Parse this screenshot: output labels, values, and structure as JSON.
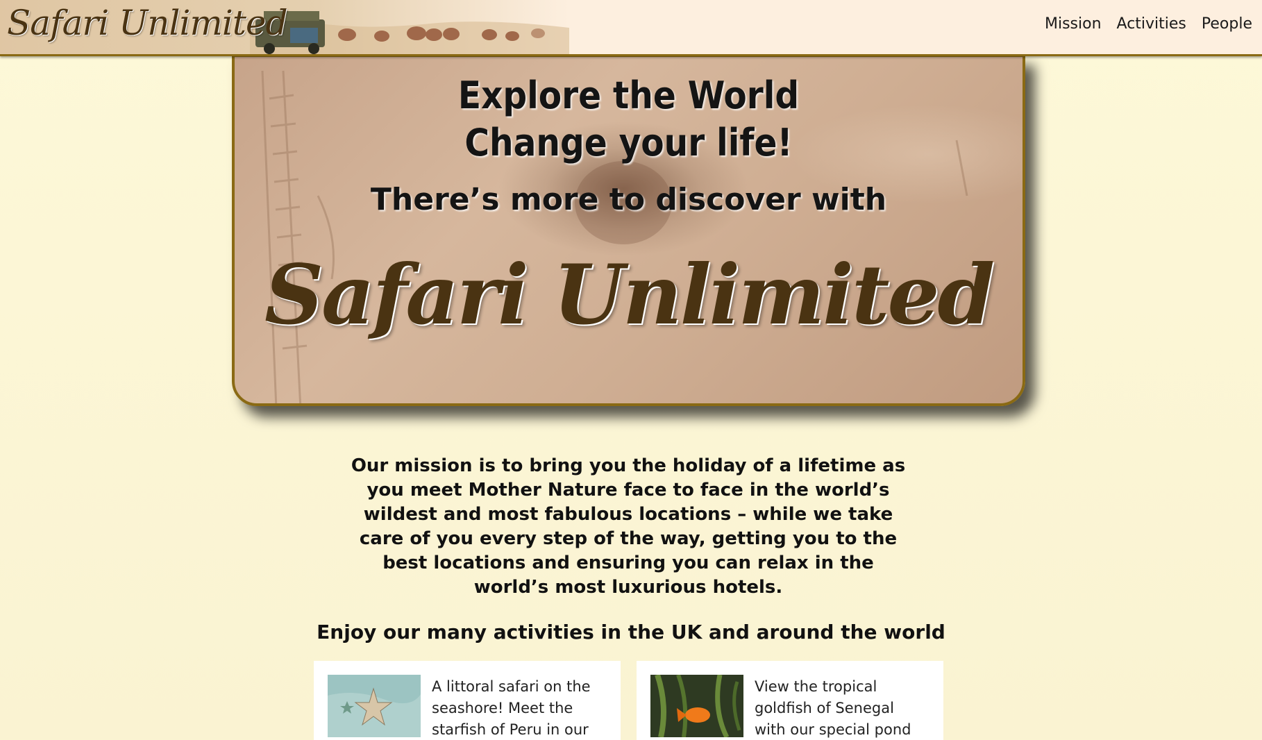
{
  "header": {
    "logo": "Safari Unlimited",
    "nav": [
      {
        "label": "Mission"
      },
      {
        "label": "Activities"
      },
      {
        "label": "People"
      }
    ]
  },
  "hero": {
    "line1": "Explore the World",
    "line2": "Change your life!",
    "line3": "There’s more to discover with",
    "brand": "Safari Unlimited"
  },
  "mission": {
    "text": "Our mission is to bring you the holiday of a lifetime as you meet Mother Nature face to face in the world’s wildest and most fabulous locations – while we take care of you every step of the way, getting you to the best locations and ensuring you can relax in the world’s most luxurious hotels."
  },
  "activities": {
    "heading": "Enjoy our many activities in the UK and around the world",
    "cards": [
      {
        "text": "A littoral safari on the seashore! Meet the starfish of Peru in our",
        "image": "starfish-photo"
      },
      {
        "text": "View the tropical goldfish of Senegal with our special pond",
        "image": "goldfish-photo"
      }
    ]
  },
  "colors": {
    "accent": "#8a6a14",
    "brand_text": "#4a3312",
    "page_bg": "#fbf5d4",
    "header_bg": "#fdefdf"
  }
}
